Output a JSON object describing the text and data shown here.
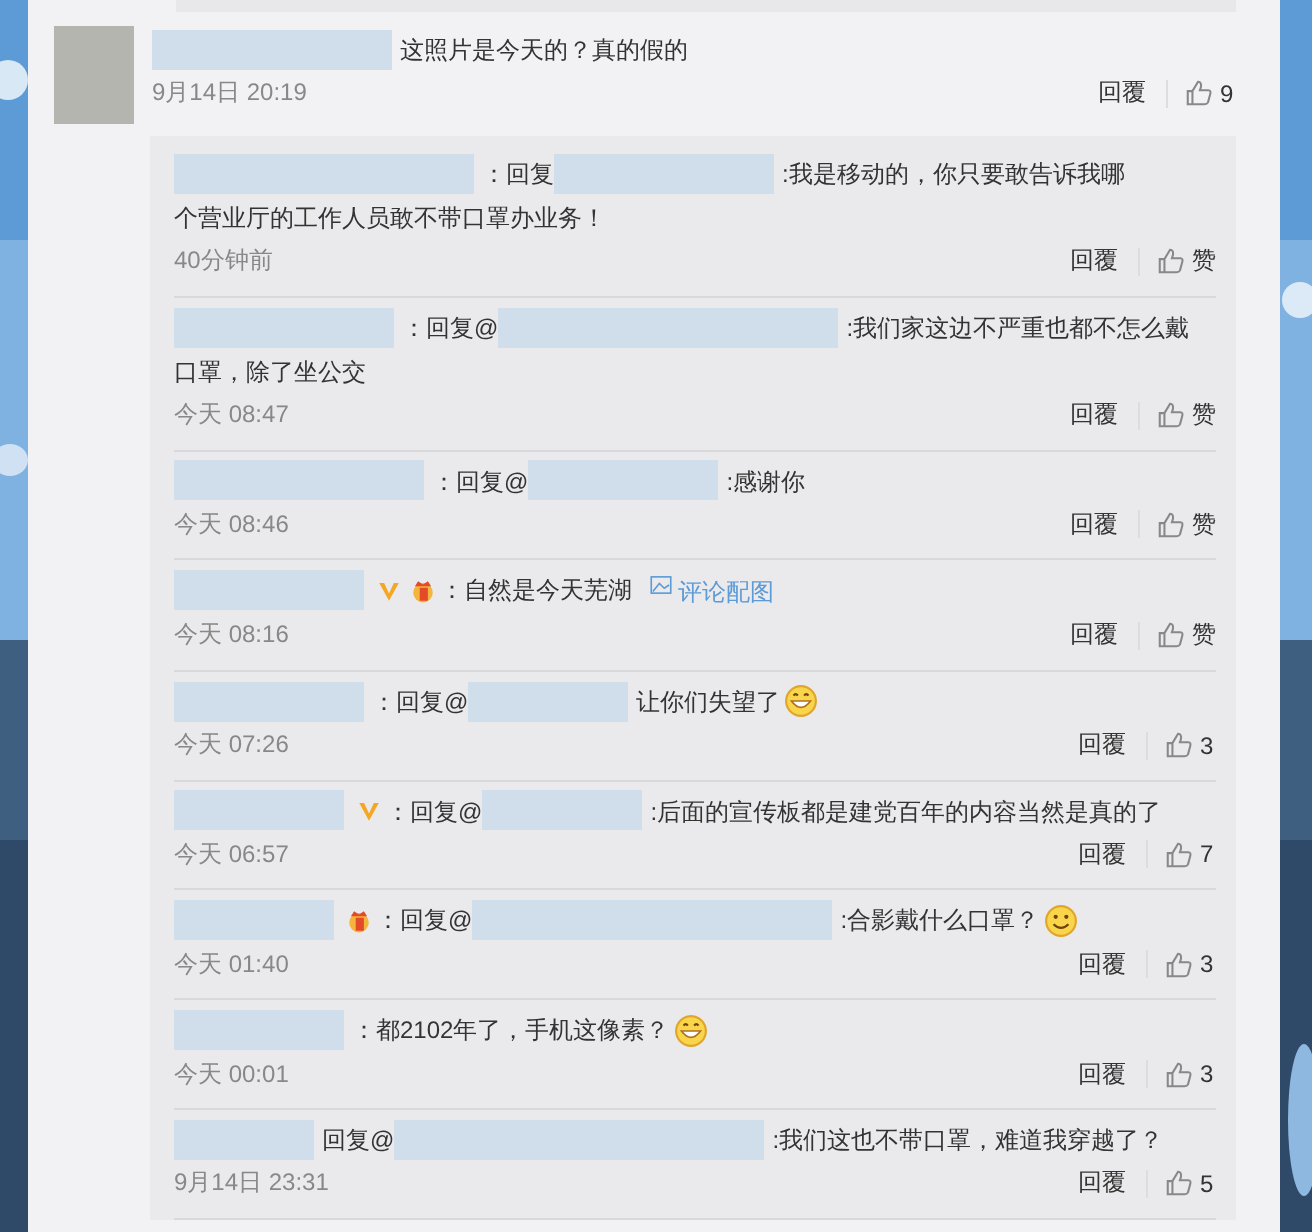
{
  "comment": {
    "content": [
      {
        "kind": "redacted"
      },
      {
        "kind": "text",
        "text": "这照片是今天的？真的假的"
      }
    ],
    "time": "9月14日 20:19",
    "reply_label": "回覆",
    "likes": "9"
  },
  "replies": [
    {
      "content": [
        {
          "kind": "redacted"
        },
        {
          "kind": "text",
          "text": "：回复"
        },
        {
          "kind": "redacted"
        },
        {
          "kind": "text",
          "text": ":我是移动的，你只要敢告诉我哪"
        },
        {
          "kind": "line",
          "text": "个营业厅的工作人员敢不带口罩办业务！"
        }
      ],
      "time": "40分钟前",
      "reply_label": "回覆",
      "likes": "赞"
    },
    {
      "content": [
        {
          "kind": "redacted"
        },
        {
          "kind": "text",
          "text": "：回复@"
        },
        {
          "kind": "redacted"
        },
        {
          "kind": "text",
          "text": ":我们家这边不严重也都不怎么戴"
        },
        {
          "kind": "line",
          "text": "口罩，除了坐公交"
        }
      ],
      "time": "今天 08:47",
      "reply_label": "回覆",
      "likes": "赞"
    },
    {
      "content": [
        {
          "kind": "redacted"
        },
        {
          "kind": "text",
          "text": "：回复@"
        },
        {
          "kind": "redacted"
        },
        {
          "kind": "text",
          "text": ":感谢你"
        }
      ],
      "time": "今天 08:46",
      "reply_label": "回覆",
      "likes": "赞"
    },
    {
      "content": [
        {
          "kind": "redacted"
        },
        {
          "kind": "verified"
        },
        {
          "kind": "member"
        },
        {
          "kind": "text",
          "text": "：自然是今天芜湖"
        },
        {
          "kind": "link",
          "text": "评论配图"
        }
      ],
      "time": "今天 08:16",
      "reply_label": "回覆",
      "likes": "赞"
    },
    {
      "content": [
        {
          "kind": "redacted"
        },
        {
          "kind": "text",
          "text": "：回复@"
        },
        {
          "kind": "redacted"
        },
        {
          "kind": "text",
          "text": "让你们失望了"
        },
        {
          "kind": "grin"
        }
      ],
      "time": "今天 07:26",
      "reply_label": "回覆",
      "likes": "3"
    },
    {
      "content": [
        {
          "kind": "redacted"
        },
        {
          "kind": "verified"
        },
        {
          "kind": "text",
          "text": "：回复@"
        },
        {
          "kind": "redacted"
        },
        {
          "kind": "text",
          "text": ":后面的宣传板都是建党百年的内容当然是真的了"
        }
      ],
      "time": "今天 06:57",
      "reply_label": "回覆",
      "likes": "7"
    },
    {
      "content": [
        {
          "kind": "redacted"
        },
        {
          "kind": "member"
        },
        {
          "kind": "text",
          "text": "：回复@"
        },
        {
          "kind": "redacted"
        },
        {
          "kind": "text",
          "text": ":合影戴什么口罩？"
        },
        {
          "kind": "smile"
        }
      ],
      "time": "今天 01:40",
      "reply_label": "回覆",
      "likes": "3"
    },
    {
      "content": [
        {
          "kind": "redacted"
        },
        {
          "kind": "text",
          "text": "：都2102年了，手机这像素？"
        },
        {
          "kind": "grin"
        }
      ],
      "time": "今天 00:01",
      "reply_label": "回覆",
      "likes": "3"
    },
    {
      "content": [
        {
          "kind": "redacted"
        },
        {
          "kind": "text",
          "text": "回复@"
        },
        {
          "kind": "redacted"
        },
        {
          "kind": "text",
          "text": ":我们这也不带口罩，难道我穿越了？"
        }
      ],
      "time": "9月14日 23:31",
      "reply_label": "回覆",
      "likes": "5"
    }
  ]
}
